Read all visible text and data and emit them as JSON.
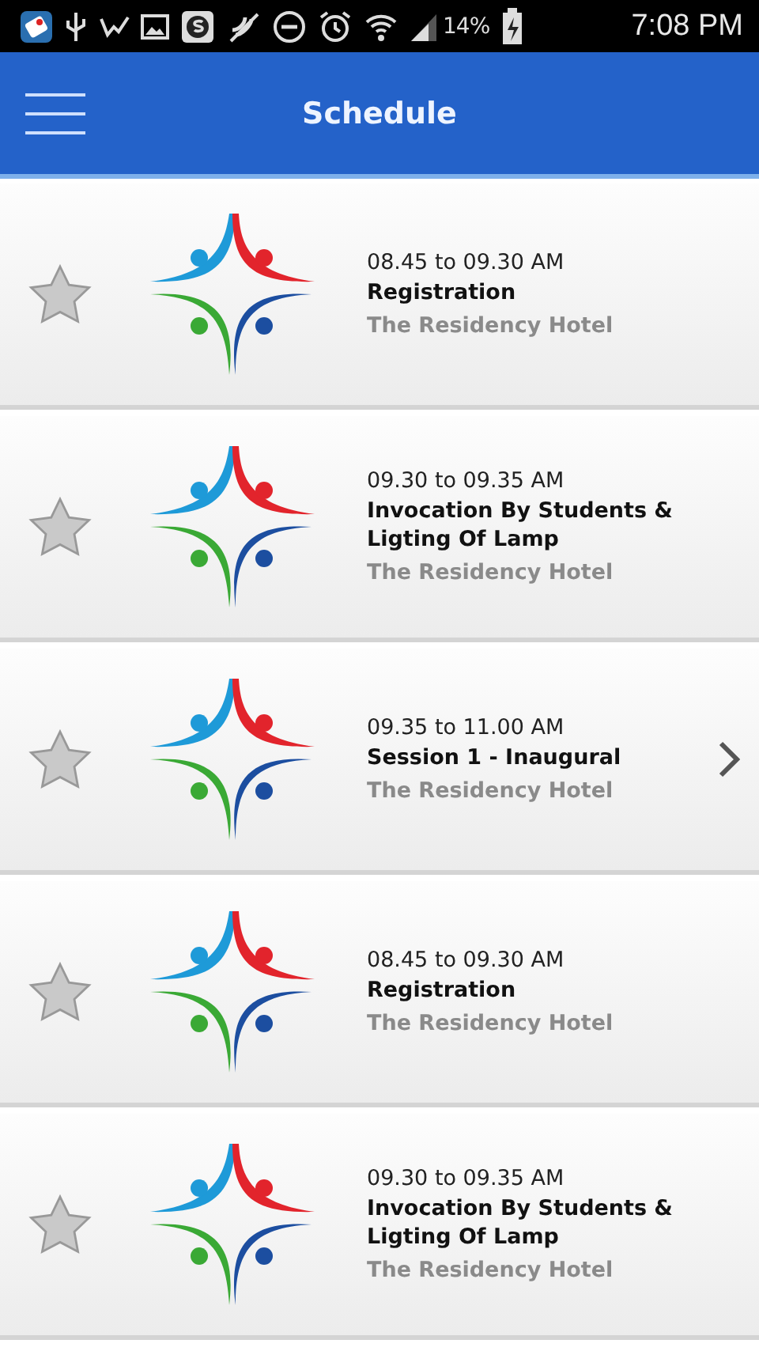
{
  "status_bar": {
    "battery": "14%",
    "time": "7:08 PM"
  },
  "app_bar": {
    "title": "Schedule"
  },
  "sessions": [
    {
      "time": "08.45 to 09.30 AM",
      "title": "Registration",
      "venue": "The Residency Hotel",
      "starred": false,
      "has_details": false
    },
    {
      "time": "09.30 to 09.35 AM",
      "title": "Invocation By Students & Ligting Of Lamp",
      "venue": "The Residency Hotel",
      "starred": false,
      "has_details": false
    },
    {
      "time": "09.35 to 11.00 AM",
      "title": "Session 1 - Inaugural",
      "venue": "The Residency Hotel",
      "starred": false,
      "has_details": true
    },
    {
      "time": "08.45 to 09.30 AM",
      "title": "Registration",
      "venue": "The Residency Hotel",
      "starred": false,
      "has_details": false
    },
    {
      "time": "09.30 to 09.35 AM",
      "title": "Invocation By Students & Ligting Of Lamp",
      "venue": "The Residency Hotel",
      "starred": false,
      "has_details": false
    }
  ]
}
